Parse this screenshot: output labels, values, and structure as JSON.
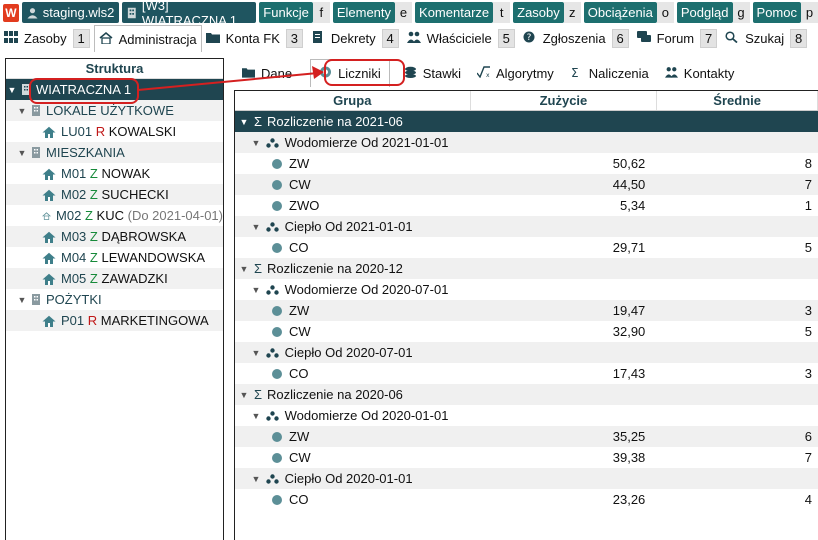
{
  "topbar": {
    "server": "staging.wls2",
    "property": "[W3] WIATRACZNA 1",
    "menus": [
      {
        "label": "Funkcje",
        "key": "f"
      },
      {
        "label": "Elementy",
        "key": "e"
      },
      {
        "label": "Komentarze",
        "key": "t"
      },
      {
        "label": "Zasoby",
        "key": "z"
      },
      {
        "label": "Obciążenia",
        "key": "o"
      },
      {
        "label": "Podgląd",
        "key": "g"
      },
      {
        "label": "Pomoc",
        "key": "p"
      }
    ]
  },
  "tabs": [
    {
      "label": "Zasoby",
      "num": "1",
      "icon": "grid-icon"
    },
    {
      "label": "Administracja",
      "num": "",
      "icon": "home-icon"
    },
    {
      "label": "Konta FK",
      "num": "3",
      "icon": "folder-icon"
    },
    {
      "label": "Dekrety",
      "num": "4",
      "icon": "document-icon"
    },
    {
      "label": "Właściciele",
      "num": "5",
      "icon": "users-icon"
    },
    {
      "label": "Zgłoszenia",
      "num": "6",
      "icon": "question-icon"
    },
    {
      "label": "Forum",
      "num": "7",
      "icon": "chat-icon"
    },
    {
      "label": "Szukaj",
      "num": "8",
      "icon": "search-icon"
    }
  ],
  "left": {
    "title": "Struktura",
    "root": "WIATRACZNA 1",
    "groups": [
      {
        "label": "LOKALE UŻYTKOWE",
        "items": [
          {
            "code": "LU01",
            "tag": "R",
            "name": "KOWALSKI",
            "extra": ""
          }
        ]
      },
      {
        "label": "MIESZKANIA",
        "items": [
          {
            "code": "M01",
            "tag": "Z",
            "name": "NOWAK",
            "extra": ""
          },
          {
            "code": "M02",
            "tag": "Z",
            "name": "SUCHECKI",
            "extra": ""
          },
          {
            "code": "M02",
            "tag": "Z",
            "name": "KUC",
            "extra": "(Do 2021-04-01)"
          },
          {
            "code": "M03",
            "tag": "Z",
            "name": "DĄBROWSKA",
            "extra": ""
          },
          {
            "code": "M04",
            "tag": "Z",
            "name": "LEWANDOWSKA",
            "extra": ""
          },
          {
            "code": "M05",
            "tag": "Z",
            "name": "ZAWADZKI",
            "extra": ""
          }
        ]
      },
      {
        "label": "POŻYTKI",
        "items": [
          {
            "code": "P01",
            "tag": "R",
            "name": "MARKETINGOWA",
            "extra": ""
          }
        ]
      }
    ]
  },
  "rtabs": [
    {
      "label": "Dane",
      "icon": "folder-icon"
    },
    {
      "label": "Liczniki",
      "icon": "meter-icon"
    },
    {
      "label": "Stawki",
      "icon": "coins-icon"
    },
    {
      "label": "Algorytmy",
      "icon": "sqrt-icon"
    },
    {
      "label": "Naliczenia",
      "icon": "sigma-icon"
    },
    {
      "label": "Kontakty",
      "icon": "users-icon"
    }
  ],
  "grid": {
    "headers": [
      "Grupa",
      "Zużycie",
      "Średnie"
    ],
    "sections": [
      {
        "label": "Rozliczenie na 2021-06",
        "groups": [
          {
            "label": "Wodomierze Od 2021-01-01",
            "rows": [
              {
                "name": "ZW",
                "usage": "50,62",
                "avg": "8"
              },
              {
                "name": "CW",
                "usage": "44,50",
                "avg": "7"
              },
              {
                "name": "ZWO",
                "usage": "5,34",
                "avg": "1"
              }
            ]
          },
          {
            "label": "Ciepło Od 2021-01-01",
            "rows": [
              {
                "name": "CO",
                "usage": "29,71",
                "avg": "5"
              }
            ]
          }
        ]
      },
      {
        "label": "Rozliczenie na 2020-12",
        "groups": [
          {
            "label": "Wodomierze Od 2020-07-01",
            "rows": [
              {
                "name": "ZW",
                "usage": "19,47",
                "avg": "3"
              },
              {
                "name": "CW",
                "usage": "32,90",
                "avg": "5"
              }
            ]
          },
          {
            "label": "Ciepło Od 2020-07-01",
            "rows": [
              {
                "name": "CO",
                "usage": "17,43",
                "avg": "3"
              }
            ]
          }
        ]
      },
      {
        "label": "Rozliczenie na 2020-06",
        "groups": [
          {
            "label": "Wodomierze Od 2020-01-01",
            "rows": [
              {
                "name": "ZW",
                "usage": "35,25",
                "avg": "6"
              },
              {
                "name": "CW",
                "usage": "39,38",
                "avg": "7"
              }
            ]
          },
          {
            "label": "Ciepło Od 2020-01-01",
            "rows": [
              {
                "name": "CO",
                "usage": "23,26",
                "avg": "4"
              }
            ]
          }
        ]
      }
    ]
  },
  "colors": {
    "accent": "#1f4550",
    "annotation": "#d42020"
  }
}
